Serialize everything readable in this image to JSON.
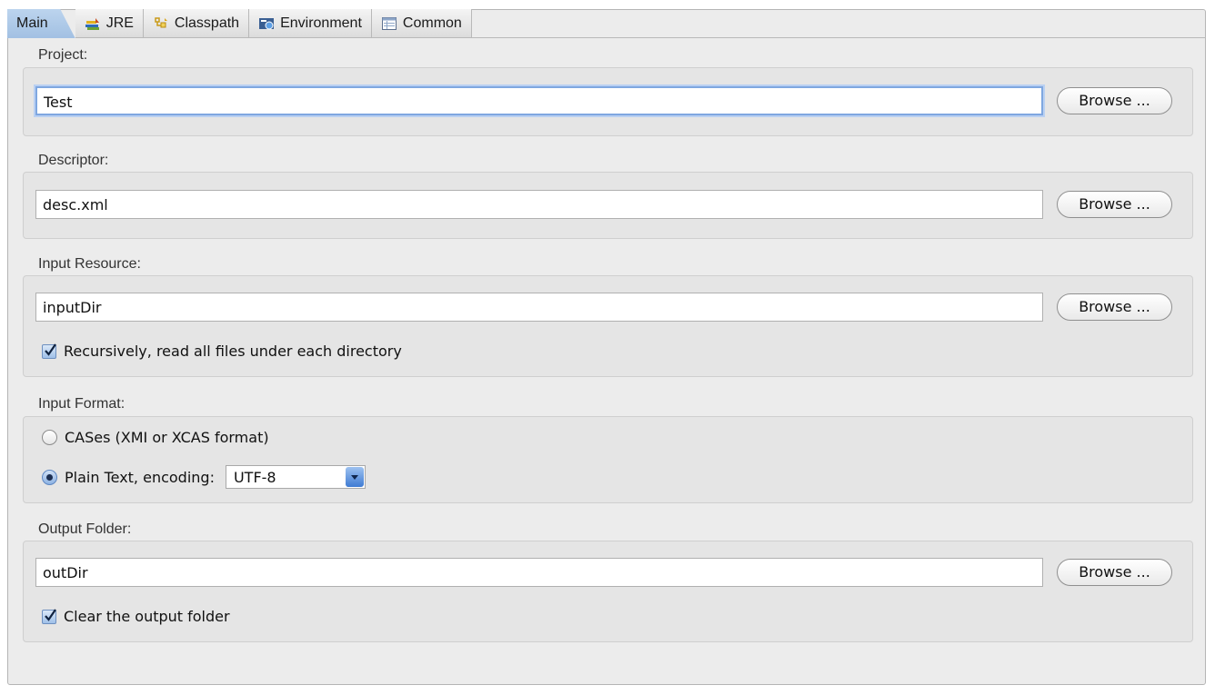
{
  "tabs": [
    {
      "label": "Main",
      "icon": "main-tab",
      "active": true
    },
    {
      "label": "JRE",
      "icon": "jre-icon",
      "active": false
    },
    {
      "label": "Classpath",
      "icon": "classpath-icon",
      "active": false
    },
    {
      "label": "Environment",
      "icon": "environment-icon",
      "active": false
    },
    {
      "label": "Common",
      "icon": "common-icon",
      "active": false
    }
  ],
  "project": {
    "label": "Project:",
    "value": "Test",
    "browse": "Browse ..."
  },
  "descriptor": {
    "label": "Descriptor:",
    "value": "desc.xml",
    "browse": "Browse ..."
  },
  "input_resource": {
    "label": "Input Resource:",
    "value": "inputDir",
    "browse": "Browse ...",
    "recursive_label": "Recursively, read all files under each directory",
    "recursive_checked": true
  },
  "input_format": {
    "label": "Input Format:",
    "cases_label": "CASes (XMI or XCAS format)",
    "cases_selected": false,
    "plain_label": "Plain Text, encoding:",
    "plain_selected": true,
    "encoding": "UTF-8"
  },
  "output_folder": {
    "label": "Output Folder:",
    "value": "outDir",
    "browse": "Browse ...",
    "clear_label": "Clear the output folder",
    "clear_checked": true
  },
  "colors": {
    "active_tab": "#a3c1e3",
    "focus_ring": "#7fa7e0",
    "select_arrow": "#3f7bd3"
  }
}
